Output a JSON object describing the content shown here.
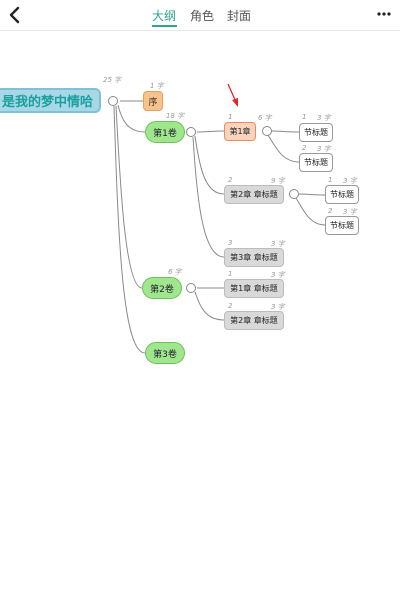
{
  "header": {
    "tabs": [
      {
        "label": "大纲",
        "active": true
      },
      {
        "label": "角色",
        "active": false
      },
      {
        "label": "封面",
        "active": false
      }
    ]
  },
  "outline": {
    "root": {
      "label": "是我的梦中情哈",
      "count": "25 字"
    },
    "preface": {
      "label": "序",
      "count": "1 字"
    },
    "volumes": [
      {
        "label": "第1卷",
        "count": "18 字"
      },
      {
        "label": "第2卷",
        "count": "6 字"
      },
      {
        "label": "第3卷"
      }
    ],
    "chapters": [
      {
        "label": "第1章",
        "index": "1",
        "count": "6 字"
      },
      {
        "label": "第2章 章标题",
        "index": "2",
        "count": "9 字"
      },
      {
        "label": "第3章 章标题",
        "index": "3",
        "count": "3 字"
      },
      {
        "label": "第1章 章标题",
        "index": "1",
        "count": "3 字"
      },
      {
        "label": "第2章 章标题",
        "index": "2",
        "count": "3 字"
      }
    ],
    "sections": [
      {
        "label": "节标题",
        "index": "1",
        "count": "3 字"
      },
      {
        "label": "节标题",
        "index": "2",
        "count": "3 字"
      },
      {
        "label": "节标题",
        "index": "1",
        "count": "3 字"
      },
      {
        "label": "节标题",
        "index": "2",
        "count": "3 字"
      }
    ]
  },
  "colors": {
    "accent": "#2ea38f",
    "root_fill": "#a8d8e6",
    "volume_fill": "#9fe68c",
    "chapter_fill": "#d9d9d9",
    "selected_border": "#f08a5d",
    "annotation_arrow": "#e8262a"
  }
}
